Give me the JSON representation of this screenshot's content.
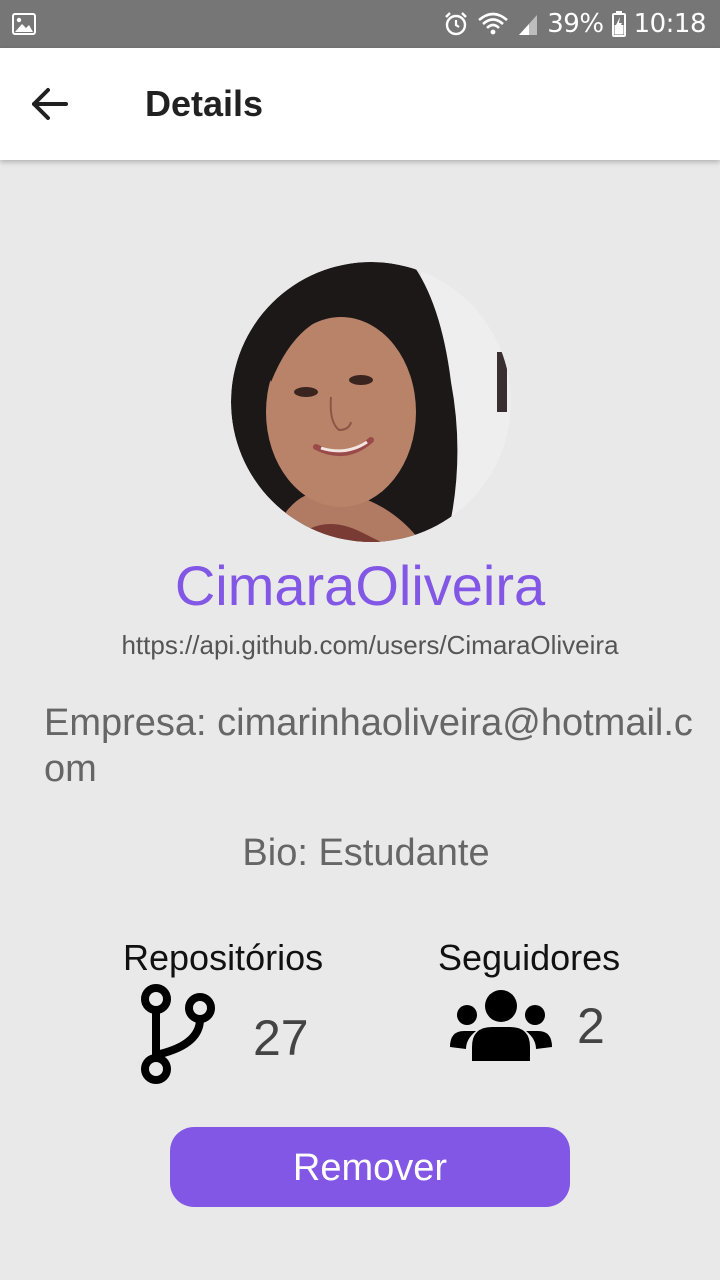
{
  "status_bar": {
    "battery": "39%",
    "time": "10:18"
  },
  "app_bar": {
    "title": "Details"
  },
  "profile": {
    "username": "CimaraOliveira",
    "url": "https://api.github.com/users/CimaraOliveira",
    "company": "Empresa: cimarinhaoliveira@hotmail.com",
    "bio": "Bio: Estudante"
  },
  "stats": {
    "repos_label": "Repositórios",
    "repos_value": "27",
    "followers_label": "Seguidores",
    "followers_value": "2"
  },
  "actions": {
    "remove_label": "Remover"
  },
  "colors": {
    "accent": "#8257e5",
    "background": "#e9e9e9",
    "status_bar": "#767676"
  },
  "icons": {
    "back": "arrow-left-icon",
    "repos": "git-branch-icon",
    "followers": "users-icon"
  }
}
